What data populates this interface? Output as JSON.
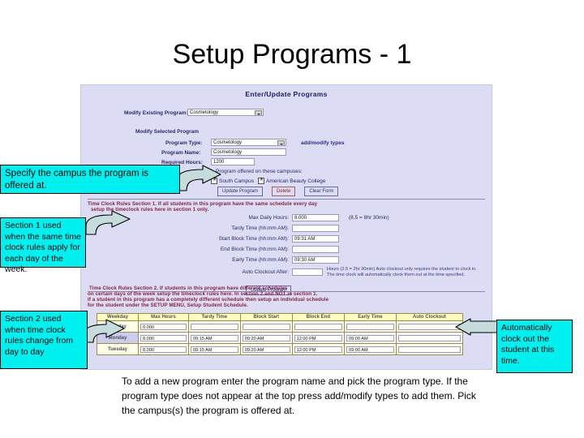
{
  "slide": {
    "title": "Setup Programs - 1",
    "caption": "To add a new program enter the program name and pick the program type.  If the program type does not appear at the top press add/modify types to add them. Pick the campus(s)  the program is offered at."
  },
  "screenshot": {
    "heading": "Enter/Update Programs",
    "modify_existing": {
      "label": "Modify Existing Program:",
      "value": "Cosmetology"
    },
    "modify_selected_label": "Modify Selected Program",
    "fields": {
      "program_type": {
        "label": "Program Type:",
        "value": "Cosmetology"
      },
      "program_name": {
        "label": "Program Name:",
        "value": "Cosmetology"
      },
      "required_hours": {
        "label": "Required Hours:",
        "value": "1200"
      }
    },
    "add_modify_types_link": "add/modify types",
    "campuses": {
      "label": "Program offered on these campuses:",
      "options": [
        {
          "label": "South Campus",
          "checked": true
        },
        {
          "label": "American Beauty College",
          "checked": true
        }
      ]
    },
    "buttons": {
      "update": "Update Program",
      "delete": "Delete",
      "clear": "Clear Form"
    },
    "section1": {
      "title_line1": "Time Clock Rules Section 1. If all students in this program have the same schedule every day",
      "title_line2": "setup the timeclock rules here in section 1 only.",
      "rows": [
        {
          "label": "Max Daily Hours:",
          "value": "8.000"
        },
        {
          "label": "Tardy Time (hh:mm AM):",
          "value": ""
        },
        {
          "label": "Start Block Time (hh:mm AM):",
          "value": "09:31 AM"
        },
        {
          "label": "End Block Time (hh:mm AM):",
          "value": ""
        },
        {
          "label": "Early Time (hh:mm AM):",
          "value": "09:30 AM"
        }
      ],
      "max_daily_hint": "(8.5 = 8hr 30min)",
      "auto_clockout_label": "Auto Clockout After:",
      "auto_clockout_value": "",
      "auto_clockout_hint_line1": "Hours (2.5 = 2hr 30min) Auto clockout only requires the student to clock in.",
      "auto_clockout_hint_line2": "The time clock will automatically clock them out at the time specified.",
      "update_button": "Update Program"
    },
    "section2": {
      "title_line1": "Time Clock Rules Section 2. If students in this program have different schedules",
      "title_line2": "on certain days of the week setup the timeclock rules here. In section 2 and NOT in section 1.",
      "title_line3": "If a student in this program has a completely different schedule then setup an individual schedule",
      "title_line4": "for the student under the SETUP MENU, Setup Student Schedule.",
      "table": {
        "headers": [
          "Weekday",
          "Max Hours",
          "Tardy Time",
          "Block Start",
          "Block End",
          "Early Time",
          "Auto Clockout"
        ],
        "rows": [
          {
            "day": "Sunday",
            "values": [
              "0.000",
              "",
              "",
              "",
              "",
              ""
            ]
          },
          {
            "day": "Monday",
            "values": [
              "8.000",
              "09:15 AM",
              "09:20 AM",
              "12:00 PM",
              "09:00 AM",
              ""
            ]
          },
          {
            "day": "Tuesday",
            "values": [
              "8.000",
              "09:15 AM",
              "09:20 AM",
              "12:00 PM",
              "09:00 AM",
              ""
            ]
          }
        ]
      }
    }
  },
  "callouts": {
    "campus": "Specify the campus the program is offered at.",
    "section1": "Section 1 used when the same time clock rules apply for each day of the week.",
    "section2": "Section 2 used when time clock rules change from day to day",
    "autoclockout": "Automatically clock out the student at this time."
  },
  "colors": {
    "callout_fill": "#00f0f0",
    "screenshot_bg": "#dcdcf4",
    "table_header": "#ffffbe",
    "section_title": "#8a2040",
    "arrow_fill": "#c6dcdc"
  }
}
